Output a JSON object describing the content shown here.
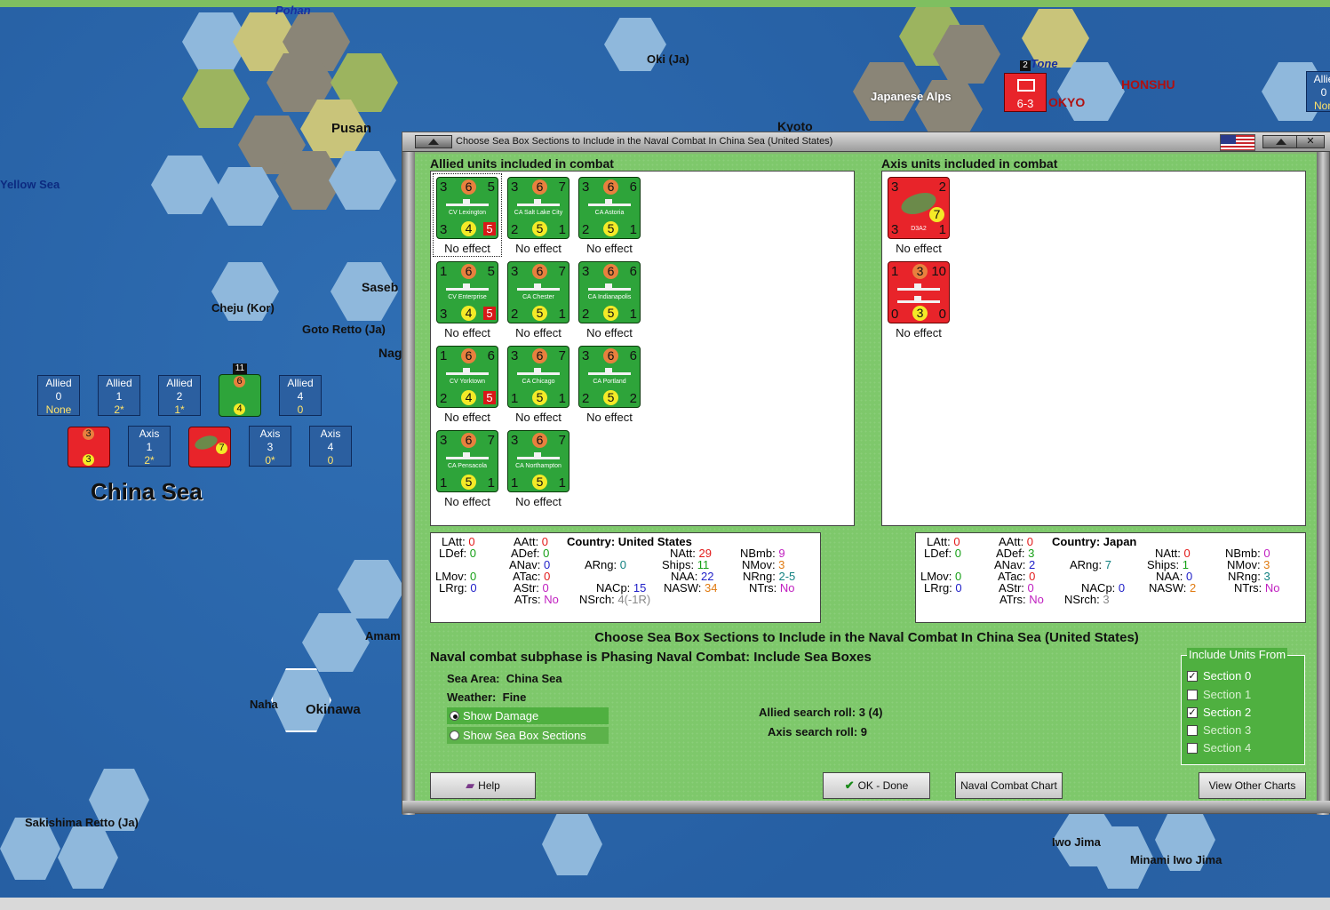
{
  "map": {
    "labels": {
      "pusan": "Pusan",
      "pohang": "Pohan",
      "oki": "Oki (Ja)",
      "yellow_sea": "Yellow Sea",
      "kyoto": "Kyoto",
      "japanese_alps": "Japanese Alps",
      "tokyo": "OKYO",
      "tone": "Tone",
      "honshu": "HONSHU",
      "cheju": "Cheju (Kor)",
      "goto": "Goto Retto (Ja)",
      "sasebo": "Saseb",
      "naga": "Nag",
      "amami": "Amam",
      "naha": "Naha",
      "okinawa": "Okinawa",
      "china_sea": "China Sea",
      "sakishima": "Sakishima Retto (Ja)",
      "iwo_jima": "Iwo Jima",
      "minami": "Minami Iwo Jima",
      "edge_allied": "Allie",
      "edge_zero": "0",
      "edge_none": "Non"
    },
    "sea_boxes": [
      {
        "side": "Allied",
        "num": "0",
        "val": "None"
      },
      {
        "side": "Allied",
        "num": "1",
        "val": "2*"
      },
      {
        "side": "Allied",
        "num": "2",
        "val": "1*"
      },
      {
        "side": "Allied",
        "num": "4",
        "val": "0"
      },
      {
        "side": "Axis",
        "num": "1",
        "val": "2*"
      },
      {
        "side": "Axis",
        "num": "3",
        "val": "0*"
      },
      {
        "side": "Axis",
        "num": "4",
        "val": "0"
      }
    ],
    "stack_count": "11",
    "tokyo_counter": "6-3",
    "tokyo_stack": "2"
  },
  "dialog": {
    "title": "Choose Sea Box Sections to Include in the Naval Combat In China Sea (United States)",
    "allied_label": "Allied units included in combat",
    "axis_label": "Axis units included in combat",
    "allied_units": [
      {
        "name": "CV Lexington",
        "tl": "3",
        "tc": "6",
        "tr": "5",
        "bl": "3",
        "bc": "4",
        "br": "5",
        "effect": "No effect",
        "brbox": true
      },
      {
        "name": "CA Salt Lake City",
        "tl": "3",
        "tc": "6",
        "tr": "7",
        "bl": "2",
        "bc": "5",
        "br": "1",
        "effect": "No effect"
      },
      {
        "name": "CA Astoria",
        "tl": "3",
        "tc": "6",
        "tr": "6",
        "bl": "2",
        "bc": "5",
        "br": "1",
        "effect": "No effect"
      },
      {
        "name": "CV Enterprise",
        "tl": "1",
        "tc": "6",
        "tr": "5",
        "bl": "3",
        "bc": "4",
        "br": "5",
        "effect": "No effect",
        "brbox": true
      },
      {
        "name": "CA Chester",
        "tl": "3",
        "tc": "6",
        "tr": "7",
        "bl": "2",
        "bc": "5",
        "br": "1",
        "effect": "No effect"
      },
      {
        "name": "CA Indianapolis",
        "tl": "3",
        "tc": "6",
        "tr": "6",
        "bl": "2",
        "bc": "5",
        "br": "1",
        "effect": "No effect"
      },
      {
        "name": "CV Yorktown",
        "tl": "1",
        "tc": "6",
        "tr": "6",
        "bl": "2",
        "bc": "4",
        "br": "5",
        "effect": "No effect",
        "brbox": true
      },
      {
        "name": "CA Chicago",
        "tl": "3",
        "tc": "6",
        "tr": "7",
        "bl": "1",
        "bc": "5",
        "br": "1",
        "effect": "No effect"
      },
      {
        "name": "CA Portland",
        "tl": "3",
        "tc": "6",
        "tr": "6",
        "bl": "2",
        "bc": "5",
        "br": "2",
        "effect": "No effect"
      },
      {
        "name": "CA Pensacola",
        "tl": "3",
        "tc": "6",
        "tr": "7",
        "bl": "1",
        "bc": "5",
        "br": "1",
        "effect": "No effect"
      },
      {
        "name": "CA Northampton",
        "tl": "3",
        "tc": "6",
        "tr": "7",
        "bl": "1",
        "bc": "5",
        "br": "1",
        "effect": "No effect"
      }
    ],
    "axis_units": [
      {
        "name": "D3A2",
        "tl": "3",
        "tr": "2",
        "bl": "3",
        "br": "1",
        "bc": "7",
        "effect": "No effect",
        "kind": "plane"
      },
      {
        "name": "",
        "tl": "1",
        "tc": "3",
        "tr": "10",
        "bl": "0",
        "bc": "3",
        "br": "0",
        "effect": "No effect",
        "kind": "ship"
      }
    ],
    "allied_stats": {
      "LAtt": "0",
      "LDef": "0",
      "LMov": "0",
      "LRrg": "0",
      "AAtt": "0",
      "ADef": "0",
      "ANav": "0",
      "ATac": "0",
      "AStr": "0",
      "ATrs": "No",
      "country_label": "Country:",
      "country": "United States",
      "ARng": "0",
      "NAtt": "29",
      "Ships": "11",
      "NAA": "22",
      "NASW": "34",
      "NACp": "15",
      "NSrch": "4(-1R)",
      "NBmb": "9",
      "NMov": "3",
      "NRng": "2-5",
      "NTrs": "No"
    },
    "axis_stats": {
      "LAtt": "0",
      "LDef": "0",
      "LMov": "0",
      "LRrg": "0",
      "AAtt": "0",
      "ADef": "3",
      "ANav": "2",
      "ATac": "0",
      "AStr": "0",
      "ATrs": "No",
      "country_label": "Country:",
      "country": "Japan",
      "ARng": "7",
      "NAtt": "0",
      "Ships": "1",
      "NAA": "0",
      "NASW": "2",
      "NACp": "0",
      "NSrch": "3",
      "NBmb": "0",
      "NMov": "3",
      "NRng": "3",
      "NTrs": "No"
    },
    "subphase": "Naval combat subphase is Phasing Naval Combat: Include Sea Boxes",
    "sea_area_label": "Sea Area:",
    "sea_area": "China Sea",
    "weather_label": "Weather:",
    "weather": "Fine",
    "show_damage": "Show Damage",
    "show_sections": "Show Sea Box Sections",
    "allied_roll": "Allied search roll: 3 (4)",
    "axis_roll": "Axis search roll: 9",
    "include_legend": "Include Units From",
    "sections": [
      {
        "label": "Section 0",
        "checked": true
      },
      {
        "label": "Section 1",
        "checked": false
      },
      {
        "label": "Section 2",
        "checked": true
      },
      {
        "label": "Section 3",
        "checked": false
      },
      {
        "label": "Section 4",
        "checked": false
      }
    ],
    "buttons": {
      "help": "Help",
      "ok": "OK - Done",
      "naval_chart": "Naval Combat Chart",
      "other_charts": "View Other Charts"
    }
  }
}
